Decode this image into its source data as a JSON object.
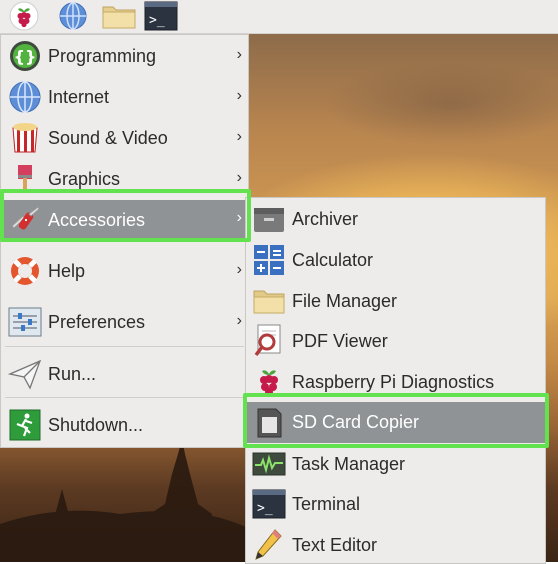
{
  "taskbar": {
    "buttons": [
      {
        "name": "raspberry-menu-button",
        "icon": "raspberry-icon"
      },
      {
        "name": "web-browser-button",
        "icon": "globe-icon"
      },
      {
        "name": "file-manager-button",
        "icon": "folder-icon"
      },
      {
        "name": "terminal-button",
        "icon": "terminal-icon"
      }
    ]
  },
  "main_menu": {
    "items": [
      {
        "label": "Programming",
        "icon": "programming-icon",
        "submenu": true
      },
      {
        "label": "Internet",
        "icon": "globe-icon",
        "submenu": true
      },
      {
        "label": "Sound & Video",
        "icon": "sound-video-icon",
        "submenu": true
      },
      {
        "label": "Graphics",
        "icon": "paintbrush-icon",
        "submenu": true
      },
      {
        "label": "Accessories",
        "icon": "pocket-knife-icon",
        "submenu": true,
        "active": true
      },
      {
        "label": "Help",
        "icon": "lifebuoy-icon",
        "submenu": true
      },
      {
        "label": "Preferences",
        "icon": "sliders-icon",
        "submenu": true
      },
      {
        "label": "Run...",
        "icon": "paper-plane-icon",
        "submenu": false
      },
      {
        "label": "Shutdown...",
        "icon": "exit-icon",
        "submenu": false
      }
    ],
    "arrow_glyph": "›"
  },
  "accessories_menu": {
    "items": [
      {
        "label": "Archiver",
        "icon": "archive-icon"
      },
      {
        "label": "Calculator",
        "icon": "calculator-icon"
      },
      {
        "label": "File Manager",
        "icon": "folder-icon"
      },
      {
        "label": "PDF Viewer",
        "icon": "pdf-viewer-icon"
      },
      {
        "label": "Raspberry Pi Diagnostics",
        "icon": "raspberry-icon"
      },
      {
        "label": "SD Card Copier",
        "icon": "sd-card-icon",
        "active": true
      },
      {
        "label": "Task Manager",
        "icon": "task-manager-icon"
      },
      {
        "label": "Terminal",
        "icon": "terminal-icon"
      },
      {
        "label": "Text Editor",
        "icon": "pencil-icon"
      }
    ]
  },
  "colors": {
    "menu_bg": "#edecea",
    "selected_bg": "#8f9396",
    "highlight_outline": "#62e24f"
  }
}
